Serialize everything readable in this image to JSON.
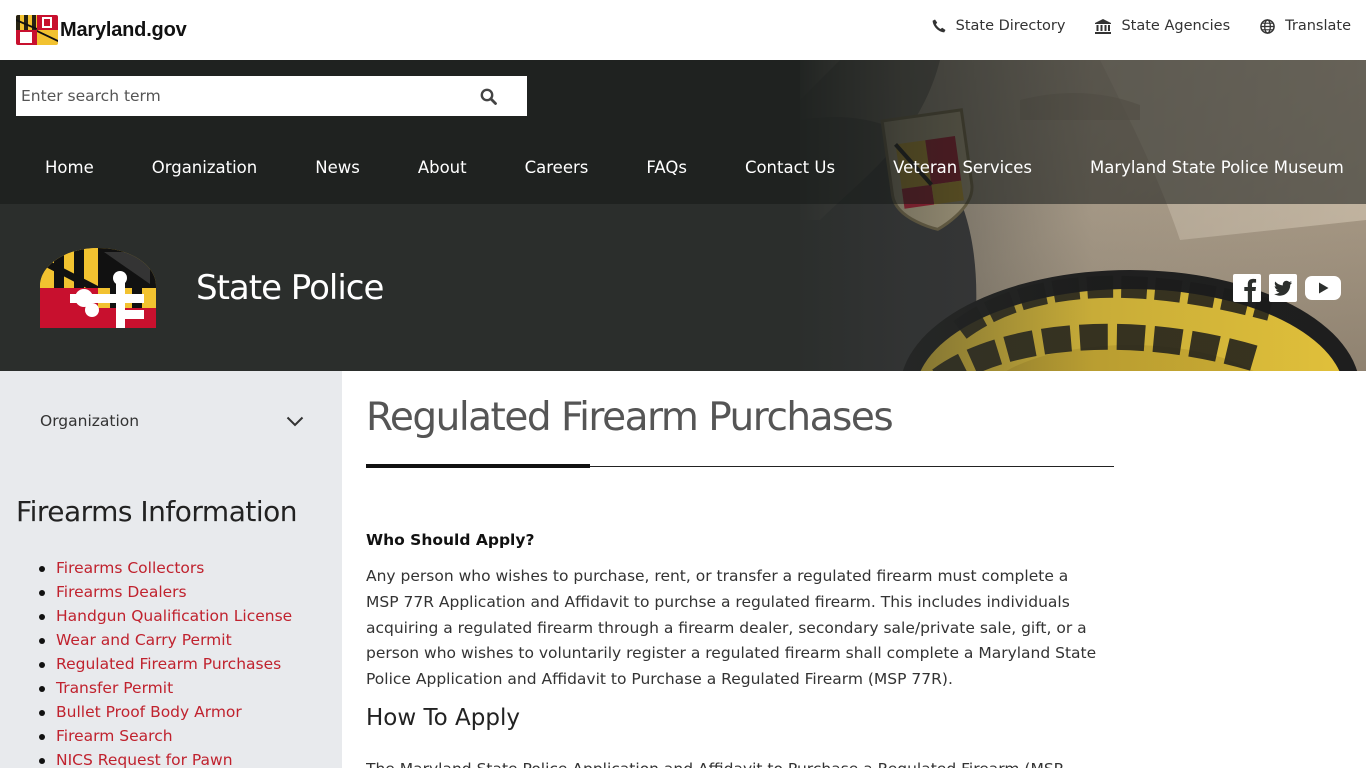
{
  "topbar": {
    "logo_text": "Maryland.gov",
    "links": [
      {
        "label": "State Directory",
        "icon": "phone-icon"
      },
      {
        "label": "State Agencies",
        "icon": "building-icon"
      },
      {
        "label": "Translate",
        "icon": "globe-icon"
      }
    ]
  },
  "search": {
    "placeholder": "Enter search term",
    "value": ""
  },
  "nav": {
    "items": [
      "Home",
      "Organization",
      "News",
      "About",
      "Careers",
      "FAQs",
      "Contact Us",
      "Veteran Services",
      "Maryland State Police Museum"
    ]
  },
  "agency": {
    "title": "State Police"
  },
  "social": [
    "facebook-icon",
    "twitter-icon",
    "youtube-icon"
  ],
  "sidebar": {
    "org_label": "Organization",
    "title": "Firearms Information",
    "links": [
      "Firearms Collectors",
      "Firearms Dealers",
      "Handgun Qualification License",
      "Wear and Carry Permit",
      "Regulated Firearm Purchases",
      "Transfer Permit",
      "Bullet Proof Body Armor",
      "Firearm Search",
      "NICS Request for Pawn"
    ]
  },
  "content": {
    "title": "Regulated Firearm Purchases",
    "section_label": "Who Should Apply?",
    "paragraph_lines": [
      "Any person who wishes to purchase, rent, or transfer a regulated firearm must complete a",
      "MSP 77R Application and Affidavit to purchse a regulated firearm. This includes individuals",
      "acquiring a regulated firearm through a firearm dealer, secondary sale/private sale, gift, or a",
      "person who wishes to voluntarily register a regulated firearm shall complete a Maryland State",
      "Police Application and Affidavit to Purchase a Regulated Firearm (MSP 77R)."
    ],
    "heading2": "How To Apply",
    "paragraph2": "The Maryland State Police Application and Affidavit to Purchase a Regulated Firearm (MSP"
  },
  "colors": {
    "link_red": "#c0222e",
    "nav_bg": "#2c2f2d",
    "sidebar_bg": "#e8eaed",
    "md_gold": "#f2c230",
    "md_red": "#c8102e"
  }
}
